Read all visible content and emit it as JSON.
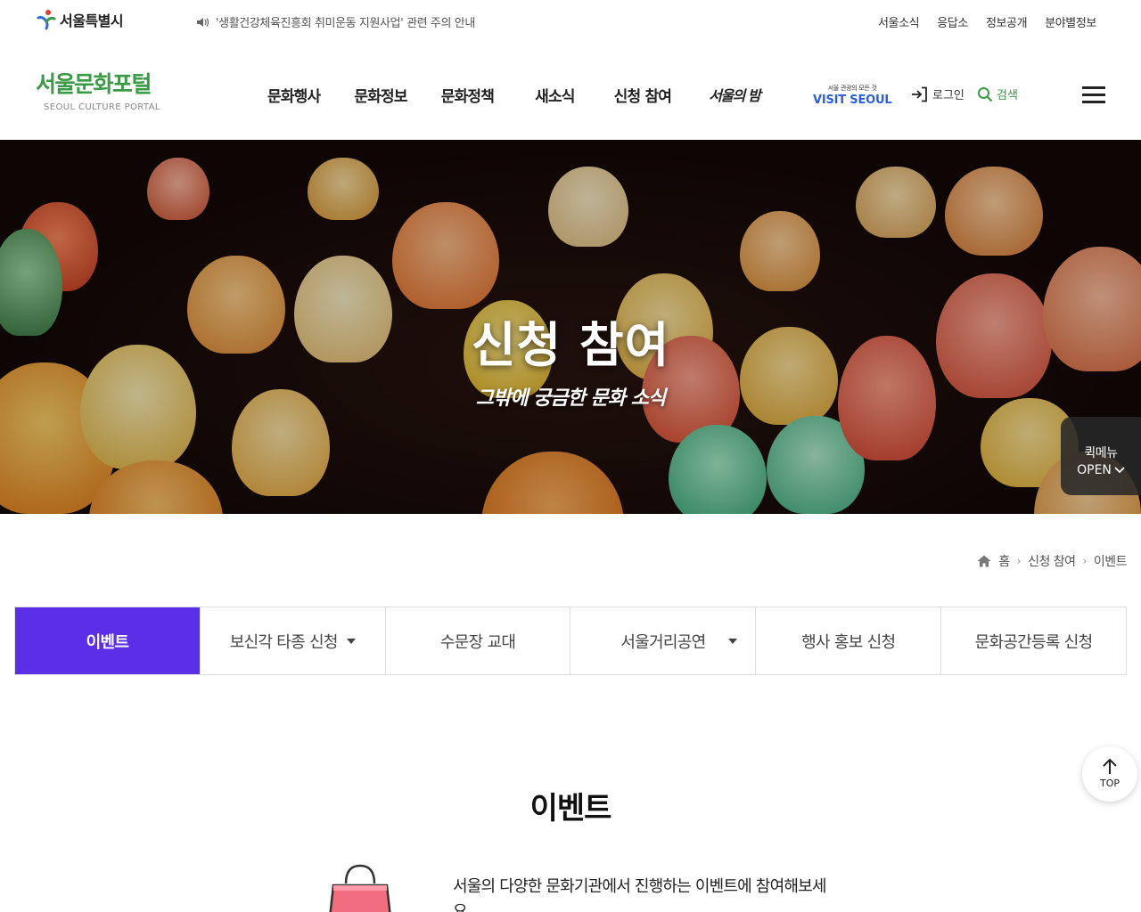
{
  "utility": {
    "seoul_logo_text": "서울특별시",
    "notice_text": "'생활건강체육진흥회 취미운동 지원사업' 관련 주의 안내",
    "links": [
      "서울소식",
      "응답소",
      "정보공개",
      "분야별정보"
    ]
  },
  "header": {
    "logo_ko": "서울문화포털",
    "logo_en": "SEOUL CULTURE PORTAL",
    "nav": [
      "문화행사",
      "문화정보",
      "문화정책",
      "새소식",
      "신청 참여",
      "서울의 밤"
    ],
    "visit_small": "서울 관광의 모든 것",
    "visit_big": "VISIT SEOUL",
    "login_label": "로그인",
    "search_label": "검색"
  },
  "hero": {
    "title": "신청 참여",
    "subtitle": "그밖에 궁금한 문화 소식",
    "quickmenu_line1": "퀵메뉴",
    "quickmenu_line2": "OPEN"
  },
  "breadcrumb": {
    "home": "홈",
    "level1": "신청 참여",
    "level2": "이벤트"
  },
  "tabs": [
    {
      "label": "이벤트",
      "active": true,
      "dropdown": false
    },
    {
      "label": "보신각 타종 신청",
      "active": false,
      "dropdown": true
    },
    {
      "label": "수문장 교대",
      "active": false,
      "dropdown": false
    },
    {
      "label": "서울거리공연",
      "active": false,
      "dropdown": true
    },
    {
      "label": "행사 홍보 신청",
      "active": false,
      "dropdown": false
    },
    {
      "label": "문화공간등록 신청",
      "active": false,
      "dropdown": false
    }
  ],
  "section": {
    "title": "이벤트",
    "intro": "서울의 다양한 문화기관에서 진행하는 이벤트에 참여해보세요."
  },
  "top_button_label": "TOP",
  "colors": {
    "brand_green": "#3a9a45",
    "active_tab": "#5b2ee8",
    "visit_blue": "#2d5fd6"
  },
  "icons": [
    "speaker-icon",
    "login-icon",
    "search-icon",
    "menu-icon",
    "home-icon",
    "chevron-right-icon",
    "chevron-down-icon",
    "arrow-up-icon",
    "shopping-bag-icon"
  ]
}
